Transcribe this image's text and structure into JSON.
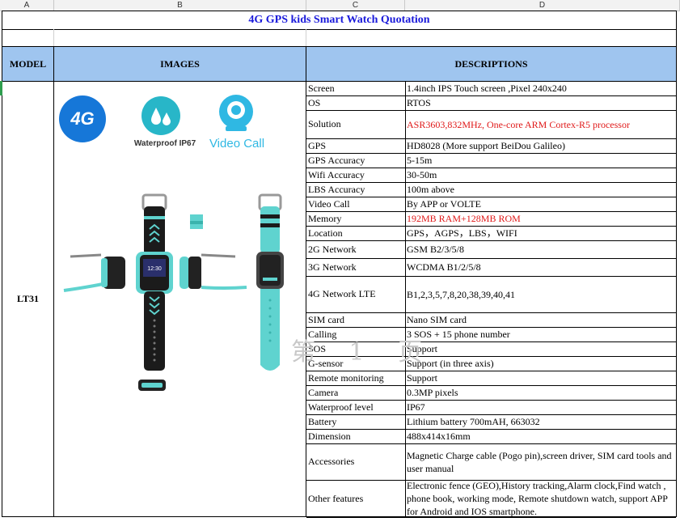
{
  "column_headers": [
    "A",
    "B",
    "C",
    "D"
  ],
  "title": "4G GPS kids Smart Watch Quotation",
  "headers": {
    "model": "MODEL",
    "images": "IMAGES",
    "descriptions": "DESCRIPTIONS"
  },
  "model": "LT31",
  "icons": {
    "lte": "4G",
    "waterproof": "Waterproof IP67",
    "video_call": "Video Call"
  },
  "watch_screen": "12:30",
  "watermark": "第 1 页",
  "colors": {
    "header_bg": "#9fc5ef",
    "title": "#1a1adb",
    "red_text": "#e01818",
    "teal": "#5fd3cf",
    "lte_blue": "#1677d8"
  },
  "specs": [
    {
      "label": "Screen",
      "value": "1.4inch IPS Touch screen ,Pixel 240x240"
    },
    {
      "label": "OS",
      "value": "RTOS"
    },
    {
      "label": "Solution",
      "value": "ASR3603,832MHz, One-core ARM Cortex-R5 processor",
      "red": true
    },
    {
      "label": "GPS",
      "value": "HD8028 (More support BeiDou Galileo)"
    },
    {
      "label": "GPS Accuracy",
      "value": "5-15m"
    },
    {
      "label": "Wifi Accuracy",
      "value": "30-50m"
    },
    {
      "label": "LBS Accuracy",
      "value": "100m above"
    },
    {
      "label": "Video Call",
      "value": "By APP or VOLTE"
    },
    {
      "label": "Memory",
      "value": "192MB RAM+128MB ROM",
      "red": true
    },
    {
      "label": "Location",
      "value": "GPS，AGPS，LBS，WIFI"
    },
    {
      "label": "2G Network",
      "value": "GSM B2/3/5/8"
    },
    {
      "label": "3G Network",
      "value": "WCDMA B1/2/5/8"
    },
    {
      "label": "4G Network LTE",
      "value": "B1,2,3,5,7,8,20,38,39,40,41"
    },
    {
      "label": "SIM card",
      "value": "Nano SIM card"
    },
    {
      "label": "Calling",
      "value": "3 SOS + 15 phone number"
    },
    {
      "label": "SOS",
      "value": "Support"
    },
    {
      "label": "G-sensor",
      "value": "Support (in three axis)"
    },
    {
      "label": "Remote monitoring",
      "value": "Support"
    },
    {
      "label": "Camera",
      "value": "0.3MP pixels"
    },
    {
      "label": "Waterproof level",
      "value": "IP67"
    },
    {
      "label": "Battery",
      "value": "Lithium battery 700mAH, 663032"
    },
    {
      "label": "Dimension",
      "value": "488x414x16mm"
    },
    {
      "label": "Accessories",
      "value": "Magnetic Charge cable (Pogo pin),screen driver, SIM card tools and user manual"
    },
    {
      "label": "Other features",
      "value": "Electronic fence (GEO),History tracking,Alarm clock,Find watch , phone book, working mode, Remote shutdown watch, support APP for Android and IOS smartphone."
    }
  ]
}
